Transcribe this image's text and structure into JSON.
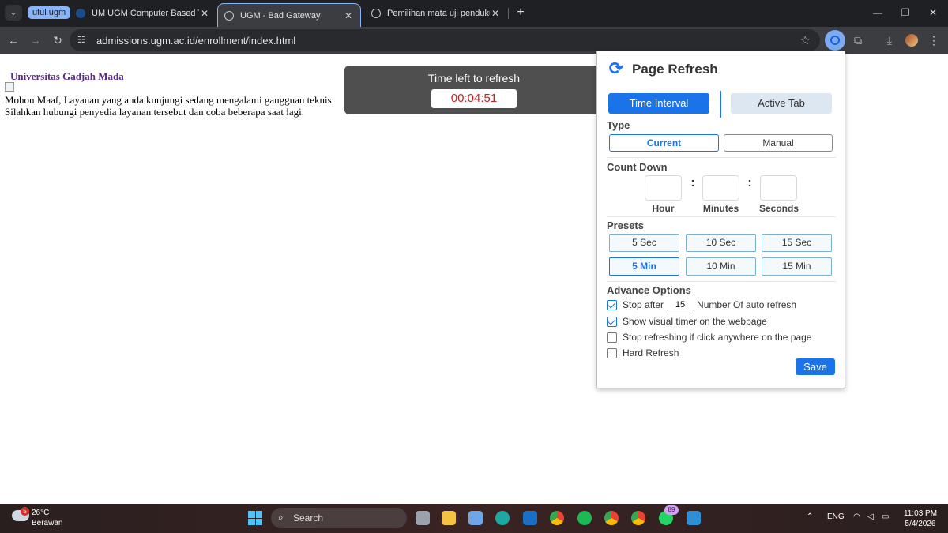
{
  "browser": {
    "tab_group": "utul ugm",
    "tabs": [
      {
        "title": "UM UGM Computer Based Test"
      },
      {
        "title": "UGM - Bad Gateway"
      },
      {
        "title": "Pemilihan mata uji pendukung"
      }
    ],
    "url": "admissions.ugm.ac.id/enrollment/index.html"
  },
  "page": {
    "university": "Universitas Gadjah Mada",
    "message_line1": "Mohon Maaf, Layanan yang anda kunjungi sedang mengalami gangguan teknis.",
    "message_line2": "Silahkan hubungi penyedia layanan tersebut dan coba beberapa saat lagi.",
    "timer_title": "Time left to refresh",
    "timer_value": "00:04:51"
  },
  "popup": {
    "title": "Page Refresh",
    "mode_interval": "Time Interval",
    "mode_active_tab": "Active Tab",
    "type_label": "Type",
    "type_current": "Current",
    "type_manual": "Manual",
    "countdown_label": "Count Down",
    "hour": "Hour",
    "minutes": "Minutes",
    "seconds": "Seconds",
    "presets_label": "Presets",
    "presets": [
      "5 Sec",
      "10 Sec",
      "15 Sec",
      "5 Min",
      "10 Min",
      "15 Min"
    ],
    "advance_label": "Advance Options",
    "stop_after_pre": "Stop after",
    "stop_after_value": "15",
    "stop_after_post": "Number Of auto refresh",
    "show_timer": "Show visual timer on the webpage",
    "stop_on_click": "Stop refreshing if click anywhere on the page",
    "hard_refresh": "Hard Refresh",
    "save": "Save"
  },
  "taskbar": {
    "weather_badge": "5",
    "temperature": "26°C",
    "weather": "Berawan",
    "search": "Search",
    "app_badge": "89",
    "lang": "ENG",
    "time": "11:03 PM",
    "date": "5/4/2026"
  }
}
